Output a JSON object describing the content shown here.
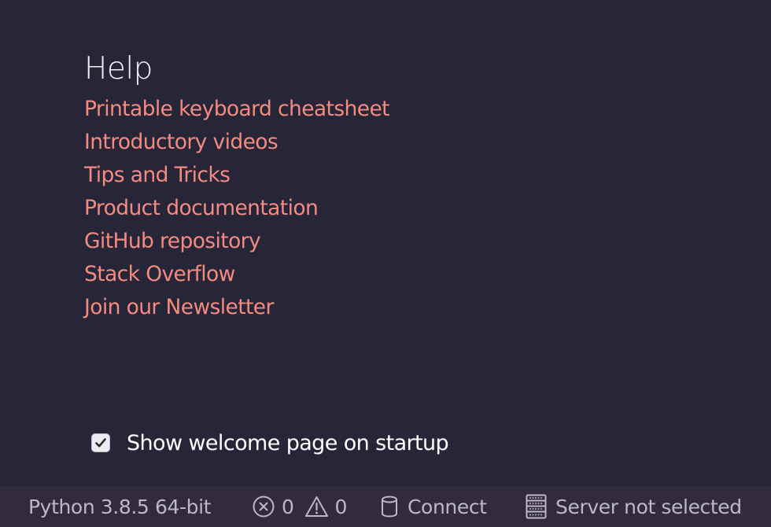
{
  "help": {
    "title": "Help",
    "links": [
      "Printable keyboard cheatsheet",
      "Introductory videos",
      "Tips and Tricks",
      "Product documentation",
      "GitHub repository",
      "Stack Overflow",
      "Join our Newsletter"
    ]
  },
  "startup": {
    "label": "Show welcome page on startup",
    "checked": true
  },
  "status_bar": {
    "interpreter": "Python 3.8.5 64-bit",
    "errors": "0",
    "warnings": "0",
    "connect": "Connect",
    "server": "Server not selected"
  },
  "colors": {
    "background": "#272538",
    "status_bar_background": "#322a3f",
    "link": "#f38b80",
    "heading": "#f4f2f8",
    "status_text": "#bcb9c7"
  },
  "icons": {
    "errors": "error-circle-icon",
    "warnings": "warning-triangle-icon",
    "connect": "database-icon",
    "server": "server-rack-icon",
    "checkbox": "checkmark-icon"
  }
}
